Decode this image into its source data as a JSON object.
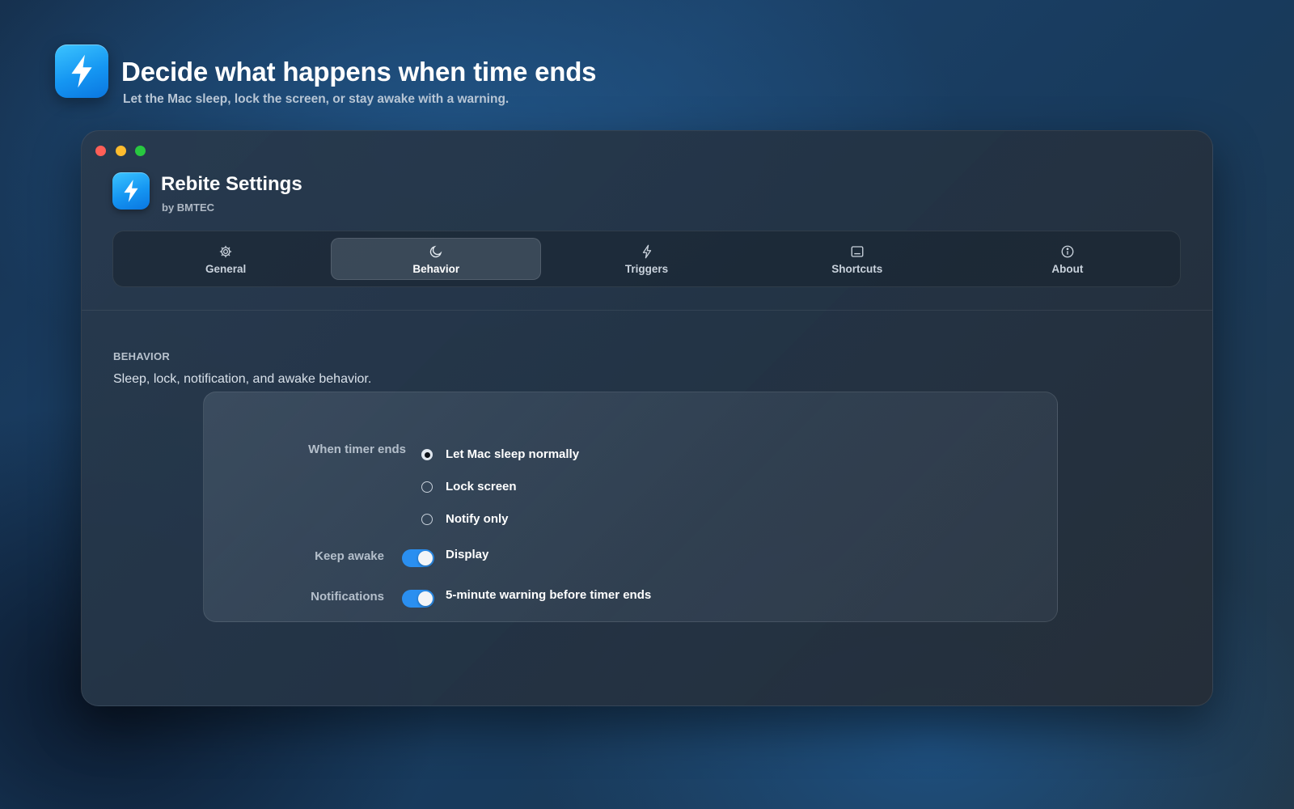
{
  "hero": {
    "icon": "bolt-icon",
    "title": "Decide what happens when time ends",
    "subtitle": "Let the Mac sleep, lock the screen, or stay awake with a warning."
  },
  "window": {
    "traffic_lights": [
      "close",
      "minimize",
      "zoom"
    ],
    "app_title": "Rebite Settings",
    "app_byline": "by BMTEC",
    "tabs": [
      {
        "label": "General",
        "icon": "gear-icon",
        "active": false
      },
      {
        "label": "Behavior",
        "icon": "moon-icon",
        "active": true
      },
      {
        "label": "Triggers",
        "icon": "bolt-icon",
        "active": false
      },
      {
        "label": "Shortcuts",
        "icon": "keyboard-icon",
        "active": false
      },
      {
        "label": "About",
        "icon": "info-icon",
        "active": false
      }
    ]
  },
  "section": {
    "heading": "BEHAVIOR",
    "description": "Sleep, lock, notification, and awake behavior."
  },
  "settings": {
    "timer_end": {
      "label": "When timer ends",
      "options": [
        {
          "label": "Let Mac sleep normally",
          "selected": true
        },
        {
          "label": "Lock screen",
          "selected": false
        },
        {
          "label": "Notify only",
          "selected": false
        }
      ]
    },
    "keep_awake": {
      "label": "Keep awake",
      "toggle_label": "Display",
      "enabled": true
    },
    "notifications": {
      "label": "Notifications",
      "toggle_label": "5-minute warning before timer ends",
      "enabled": true
    }
  },
  "colors": {
    "accent": "#2a8ff0",
    "icon_gradient_top": "#3cc4ff",
    "icon_gradient_bottom": "#0a76e0",
    "traffic_red": "#ff5f57",
    "traffic_yellow": "#febc2e",
    "traffic_green": "#28c840"
  }
}
